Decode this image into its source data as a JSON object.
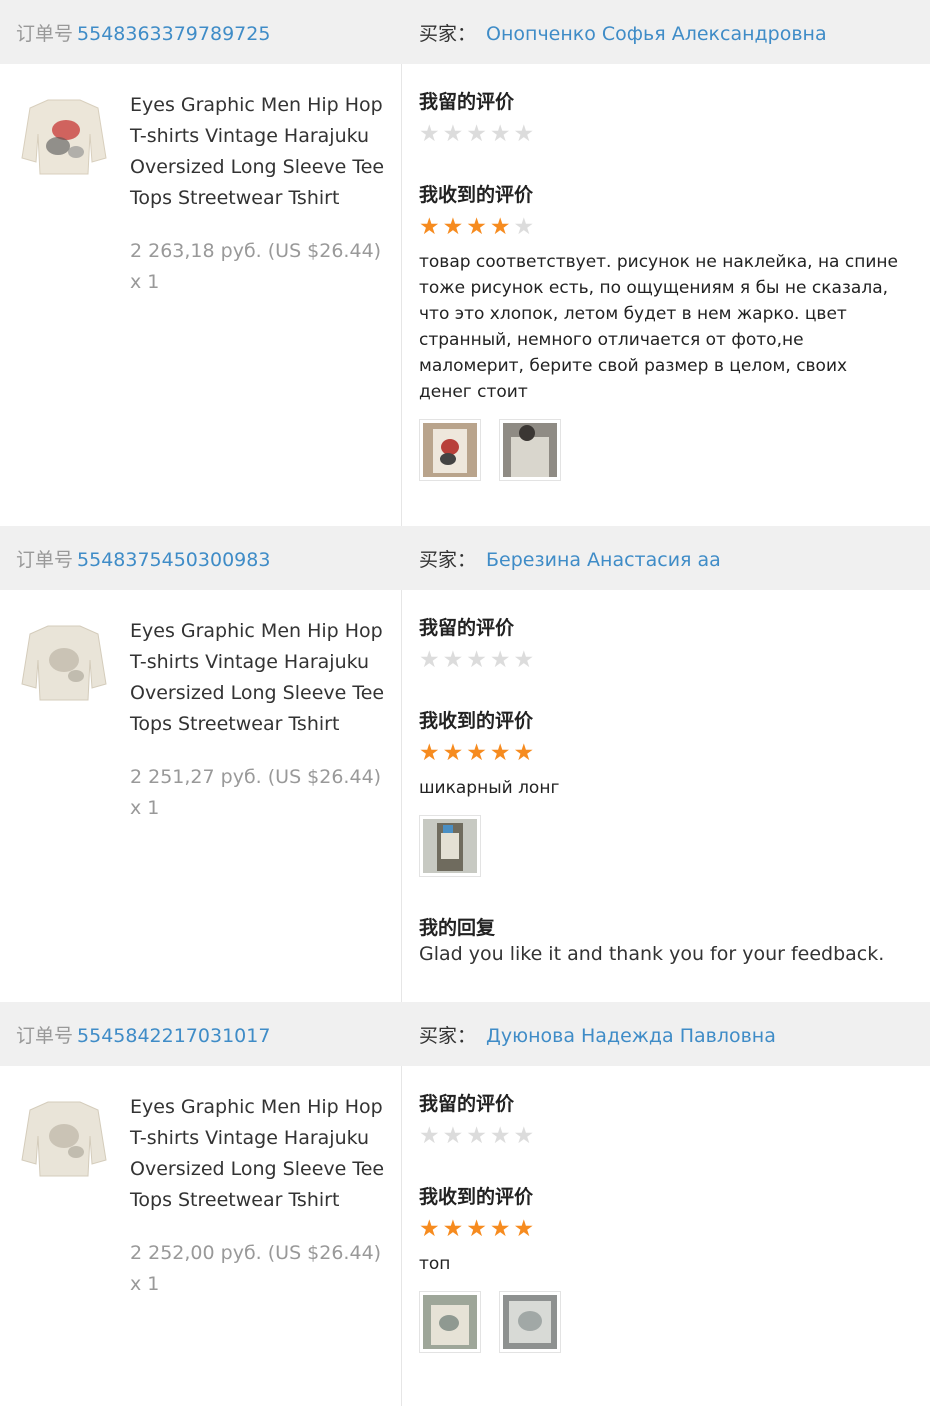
{
  "labels": {
    "order_no": "订单号",
    "buyer": "买家：",
    "my_review": "我留的评价",
    "received_review": "我收到的评价",
    "my_reply": "我的回复"
  },
  "orders": [
    {
      "order_number": "5548363379789725",
      "buyer_name": "Онопченко Софья Александровна",
      "product_title": "Eyes Graphic Men Hip Hop T-shirts Vintage Harajuku Oversized Long Sleeve Tee Tops Streetwear Tshirt",
      "price": "2 263,18 руб. (US $26.44)",
      "quantity": "x 1",
      "my_rating": 0,
      "received_rating": 4,
      "comment": "товар соответствует. рисунок не наклейка, на спине тоже рисунок есть, по ощущениям я бы не сказала, что это хлопок, летом будет в нем жарко. цвет странный, немного отличается от фото,не маломерит, берите свой размер в целом, своих денег стоит",
      "photo_count": 2
    },
    {
      "order_number": "5548375450300983",
      "buyer_name": "Березина Анастасия аа",
      "product_title": "Eyes Graphic Men Hip Hop T-shirts Vintage Harajuku Oversized Long Sleeve Tee Tops Streetwear Tshirt",
      "price": "2 251,27 руб. (US $26.44)",
      "quantity": "x 1",
      "my_rating": 0,
      "received_rating": 5,
      "comment": "шикарный лонг",
      "photo_count": 1,
      "reply": "Glad you like it and thank you for your feedback."
    },
    {
      "order_number": "5545842217031017",
      "buyer_name": "Дуюнова Надежда Павловна",
      "product_title": "Eyes Graphic Men Hip Hop T-shirts Vintage Harajuku Oversized Long Sleeve Tee Tops Streetwear Tshirt",
      "price": "2 252,00 руб. (US $26.44)",
      "quantity": "x 1",
      "my_rating": 0,
      "received_rating": 5,
      "comment": "топ",
      "photo_count": 2
    }
  ],
  "colors": {
    "link": "#3f8cc7",
    "star_on": "#f68b1f",
    "star_off": "#dcdcdc",
    "header_bg": "#f0f0f0"
  }
}
